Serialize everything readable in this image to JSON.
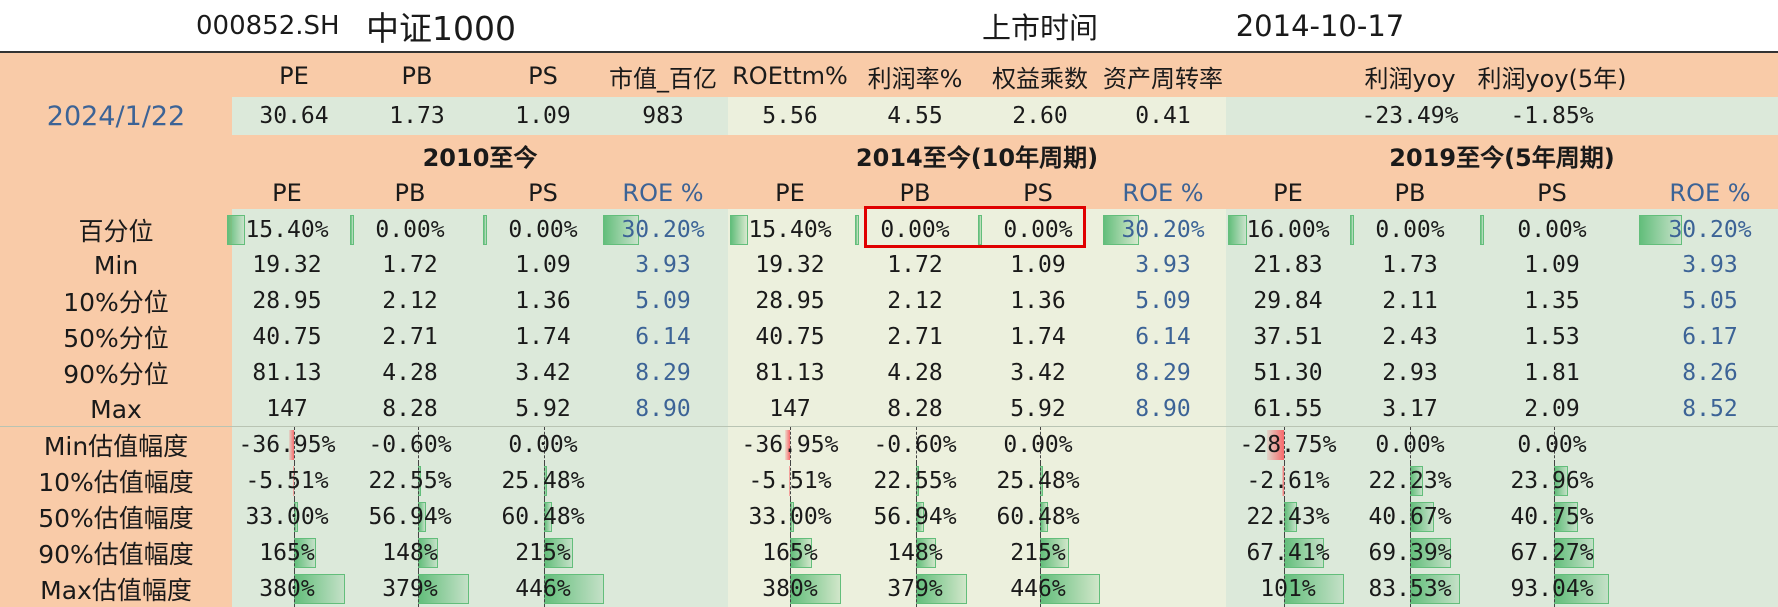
{
  "title": {
    "code": "000852.SH",
    "name": "中证1000",
    "list_label": "上市时间",
    "list_date": "2014-10-17"
  },
  "colors": {
    "label_bg": "#f9cba8",
    "green_bg": "#dce9da",
    "cream_bg": "#ecf0dd",
    "bar_green": "#63be7b",
    "bar_red": "#f8696b",
    "roe_text": "#3c6396",
    "highlight": "#e00000"
  },
  "snapshot": {
    "date": "2024/1/22",
    "headers": [
      "PE",
      "PB",
      "PS",
      "市值_百亿",
      "ROEttm%",
      "利润率%",
      "权益乘数",
      "资产周转率",
      "",
      "利润yoy",
      "利润yoy(5年)"
    ],
    "values": [
      "30.64",
      "1.73",
      "1.09",
      "983",
      "5.56",
      "4.55",
      "2.60",
      "0.41",
      "",
      "-23.49%",
      "-1.85%"
    ]
  },
  "sections": [
    "2010至今",
    "2014至今(10年周期)",
    "2019至今(5年周期)"
  ],
  "subheaders": [
    "PE",
    "PB",
    "PS",
    "ROE %",
    "PE",
    "PB",
    "PS",
    "ROE %",
    "PE",
    "PB",
    "PS",
    "ROE %"
  ],
  "percentile_row": {
    "label": "百分位",
    "values": [
      "15.40%",
      "0.00%",
      "0.00%",
      "30.20%",
      "15.40%",
      "0.00%",
      "0.00%",
      "30.20%",
      "16.00%",
      "0.00%",
      "0.00%",
      "30.20%"
    ],
    "fill": [
      0.154,
      0,
      0,
      0.302,
      0.154,
      0,
      0,
      0.302,
      0.16,
      0,
      0,
      0.302
    ]
  },
  "stat_rows": [
    {
      "label": "Min",
      "values": [
        "19.32",
        "1.72",
        "1.09",
        "3.93",
        "19.32",
        "1.72",
        "1.09",
        "3.93",
        "21.83",
        "1.73",
        "1.09",
        "3.93"
      ]
    },
    {
      "label": "10%分位",
      "values": [
        "28.95",
        "2.12",
        "1.36",
        "5.09",
        "28.95",
        "2.12",
        "1.36",
        "5.09",
        "29.84",
        "2.11",
        "1.35",
        "5.05"
      ]
    },
    {
      "label": "50%分位",
      "values": [
        "40.75",
        "2.71",
        "1.74",
        "6.14",
        "40.75",
        "2.71",
        "1.74",
        "6.14",
        "37.51",
        "2.43",
        "1.53",
        "6.17"
      ]
    },
    {
      "label": "90%分位",
      "values": [
        "81.13",
        "4.28",
        "3.42",
        "8.29",
        "81.13",
        "4.28",
        "3.42",
        "8.29",
        "51.30",
        "2.93",
        "1.81",
        "8.26"
      ]
    },
    {
      "label": "Max",
      "values": [
        "147",
        "8.28",
        "5.92",
        "8.90",
        "147",
        "8.28",
        "5.92",
        "8.90",
        "61.55",
        "3.17",
        "2.09",
        "8.52"
      ]
    }
  ],
  "range_rows": [
    {
      "label": "Min估值幅度",
      "values": [
        "-36.95%",
        "-0.60%",
        "0.00%",
        "",
        "-36.95%",
        "-0.60%",
        "0.00%",
        "",
        "-28.75%",
        "0.00%",
        "0.00%",
        ""
      ],
      "pct": [
        -36.95,
        -0.6,
        0,
        null,
        -36.95,
        -0.6,
        0,
        null,
        -28.75,
        0,
        0,
        null
      ]
    },
    {
      "label": "10%估值幅度",
      "values": [
        "-5.51%",
        "22.55%",
        "25.48%",
        "",
        "-5.51%",
        "22.55%",
        "25.48%",
        "",
        "-2.61%",
        "22.23%",
        "23.96%",
        ""
      ],
      "pct": [
        -5.51,
        22.55,
        25.48,
        null,
        -5.51,
        22.55,
        25.48,
        null,
        -2.61,
        22.23,
        23.96,
        null
      ]
    },
    {
      "label": "50%估值幅度",
      "values": [
        "33.00%",
        "56.94%",
        "60.48%",
        "",
        "33.00%",
        "56.94%",
        "60.48%",
        "",
        "22.43%",
        "40.67%",
        "40.75%",
        ""
      ],
      "pct": [
        33.0,
        56.94,
        60.48,
        null,
        33.0,
        56.94,
        60.48,
        null,
        22.43,
        40.67,
        40.75,
        null
      ]
    },
    {
      "label": "90%估值幅度",
      "values": [
        "165%",
        "148%",
        "215%",
        "",
        "165%",
        "148%",
        "215%",
        "",
        "67.41%",
        "69.39%",
        "67.27%",
        ""
      ],
      "pct": [
        165,
        148,
        215,
        null,
        165,
        148,
        215,
        null,
        67.41,
        69.39,
        67.27,
        null
      ]
    },
    {
      "label": "Max估值幅度",
      "values": [
        "380%",
        "379%",
        "446%",
        "",
        "380%",
        "379%",
        "446%",
        "",
        "101%",
        "83.53%",
        "93.04%",
        ""
      ],
      "pct": [
        380,
        379,
        446,
        null,
        380,
        379,
        446,
        null,
        101,
        83.53,
        93.04,
        null
      ]
    }
  ]
}
